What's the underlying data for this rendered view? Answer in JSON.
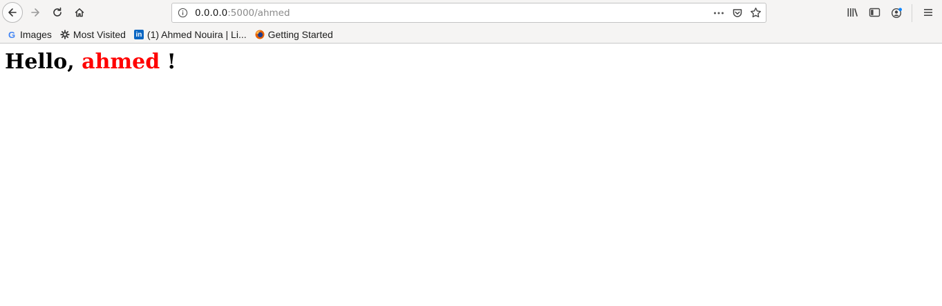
{
  "browser": {
    "url": {
      "host": "0.0.0.0",
      "path": ":5000/ahmed"
    },
    "bookmarks": [
      {
        "label": "Images",
        "icon": "google-icon"
      },
      {
        "label": "Most Visited",
        "icon": "gear-icon"
      },
      {
        "label": "(1) Ahmed Nouira | Li...",
        "icon": "linkedin-icon"
      },
      {
        "label": "Getting Started",
        "icon": "firefox-icon"
      }
    ]
  },
  "page": {
    "greeting_prefix": "Hello, ",
    "name": "ahmed",
    "greeting_suffix": " !",
    "name_color": "#ff0000"
  }
}
